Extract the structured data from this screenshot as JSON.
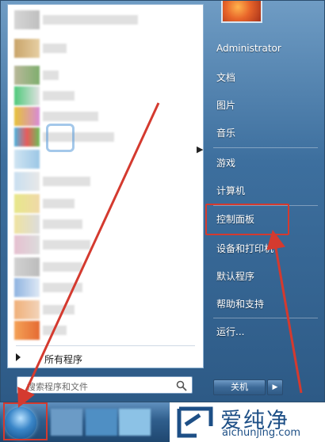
{
  "start_menu": {
    "all_programs_label": "所有程序",
    "search_placeholder": "搜索程序和文件",
    "right_items": [
      "Administrator",
      "文档",
      "图片",
      "音乐",
      "游戏",
      "计算机",
      "控制面板",
      "设备和打印机",
      "默认程序",
      "帮助和支持",
      "运行..."
    ],
    "shutdown_label": "关机",
    "shutdown_arrow_glyph": "▶",
    "submenu_glyph": "▶"
  },
  "annotation": {
    "highlight_color": "#d43a2f"
  },
  "watermark": {
    "brand": "爱纯净",
    "url": "aichunjing.com"
  }
}
